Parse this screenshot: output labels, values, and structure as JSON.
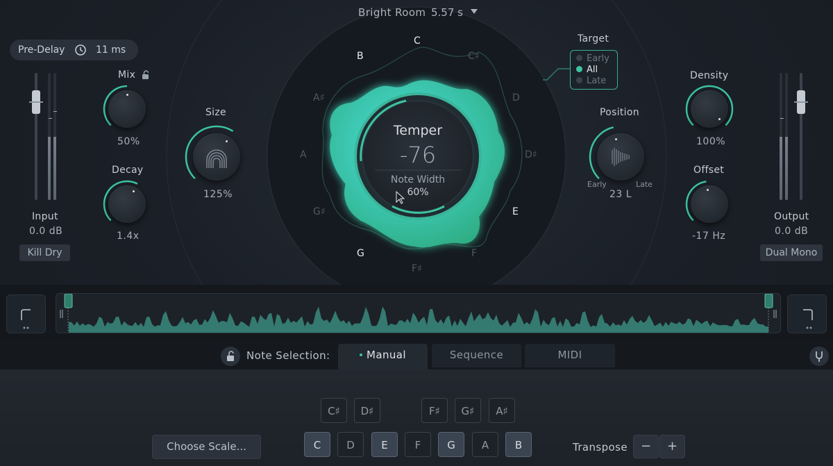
{
  "header": {
    "preset_name": "Bright Room",
    "preset_duration": "5.57 s"
  },
  "predelay": {
    "label": "Pre-Delay",
    "value": "11 ms"
  },
  "input": {
    "label": "Input",
    "value": "0.0 dB",
    "kill_dry": "Kill Dry",
    "level": 0.75
  },
  "output": {
    "label": "Output",
    "value": "0.0 dB",
    "mode": "Dual Mono",
    "level": 0.75
  },
  "mix": {
    "label": "Mix",
    "value": "50%",
    "level": 0.5
  },
  "decay": {
    "label": "Decay",
    "value": "1.4x",
    "level": 0.6
  },
  "size": {
    "label": "Size",
    "value": "125%",
    "level": 0.62
  },
  "position": {
    "label": "Position",
    "value": "23 L",
    "left": "Early",
    "right": "Late",
    "level": 0.45
  },
  "density": {
    "label": "Density",
    "value": "100%",
    "level": 1.0
  },
  "offset": {
    "label": "Offset",
    "value": "-17 Hz",
    "level": 0.47
  },
  "target": {
    "label": "Target",
    "options": [
      "Early",
      "All",
      "Late"
    ],
    "selected": "All"
  },
  "temper": {
    "title": "Temper",
    "value": "-76",
    "note_width_label": "Note Width",
    "note_width_value": "60%"
  },
  "circle_notes": {
    "active": [
      {
        "name": "B"
      },
      {
        "name": "C"
      },
      {
        "name": "E"
      },
      {
        "name": "G"
      }
    ],
    "inactive": [
      {
        "name": "C♯"
      },
      {
        "name": "D"
      },
      {
        "name": "D♯"
      },
      {
        "name": "F"
      },
      {
        "name": "F♯"
      },
      {
        "name": "G♯"
      },
      {
        "name": "A"
      },
      {
        "name": "A♯"
      }
    ]
  },
  "note_selection": {
    "label": "Note Selection:",
    "tabs": [
      "Manual",
      "Sequence",
      "MIDI"
    ],
    "active_tab": "Manual"
  },
  "keys": {
    "sharps": [
      "C♯",
      "D♯",
      "F♯",
      "G♯",
      "A♯"
    ],
    "naturals": [
      "C",
      "D",
      "E",
      "F",
      "G",
      "A",
      "B"
    ],
    "enabled": [
      "C",
      "E",
      "G",
      "B"
    ]
  },
  "scale_button": "Choose Scale...",
  "transpose": {
    "label": "Transpose",
    "minus": "−",
    "plus": "+"
  },
  "colors": {
    "accent": "#3cc4a2",
    "blob_light": "#3fe0d2",
    "blob_dark": "#2fb888"
  }
}
